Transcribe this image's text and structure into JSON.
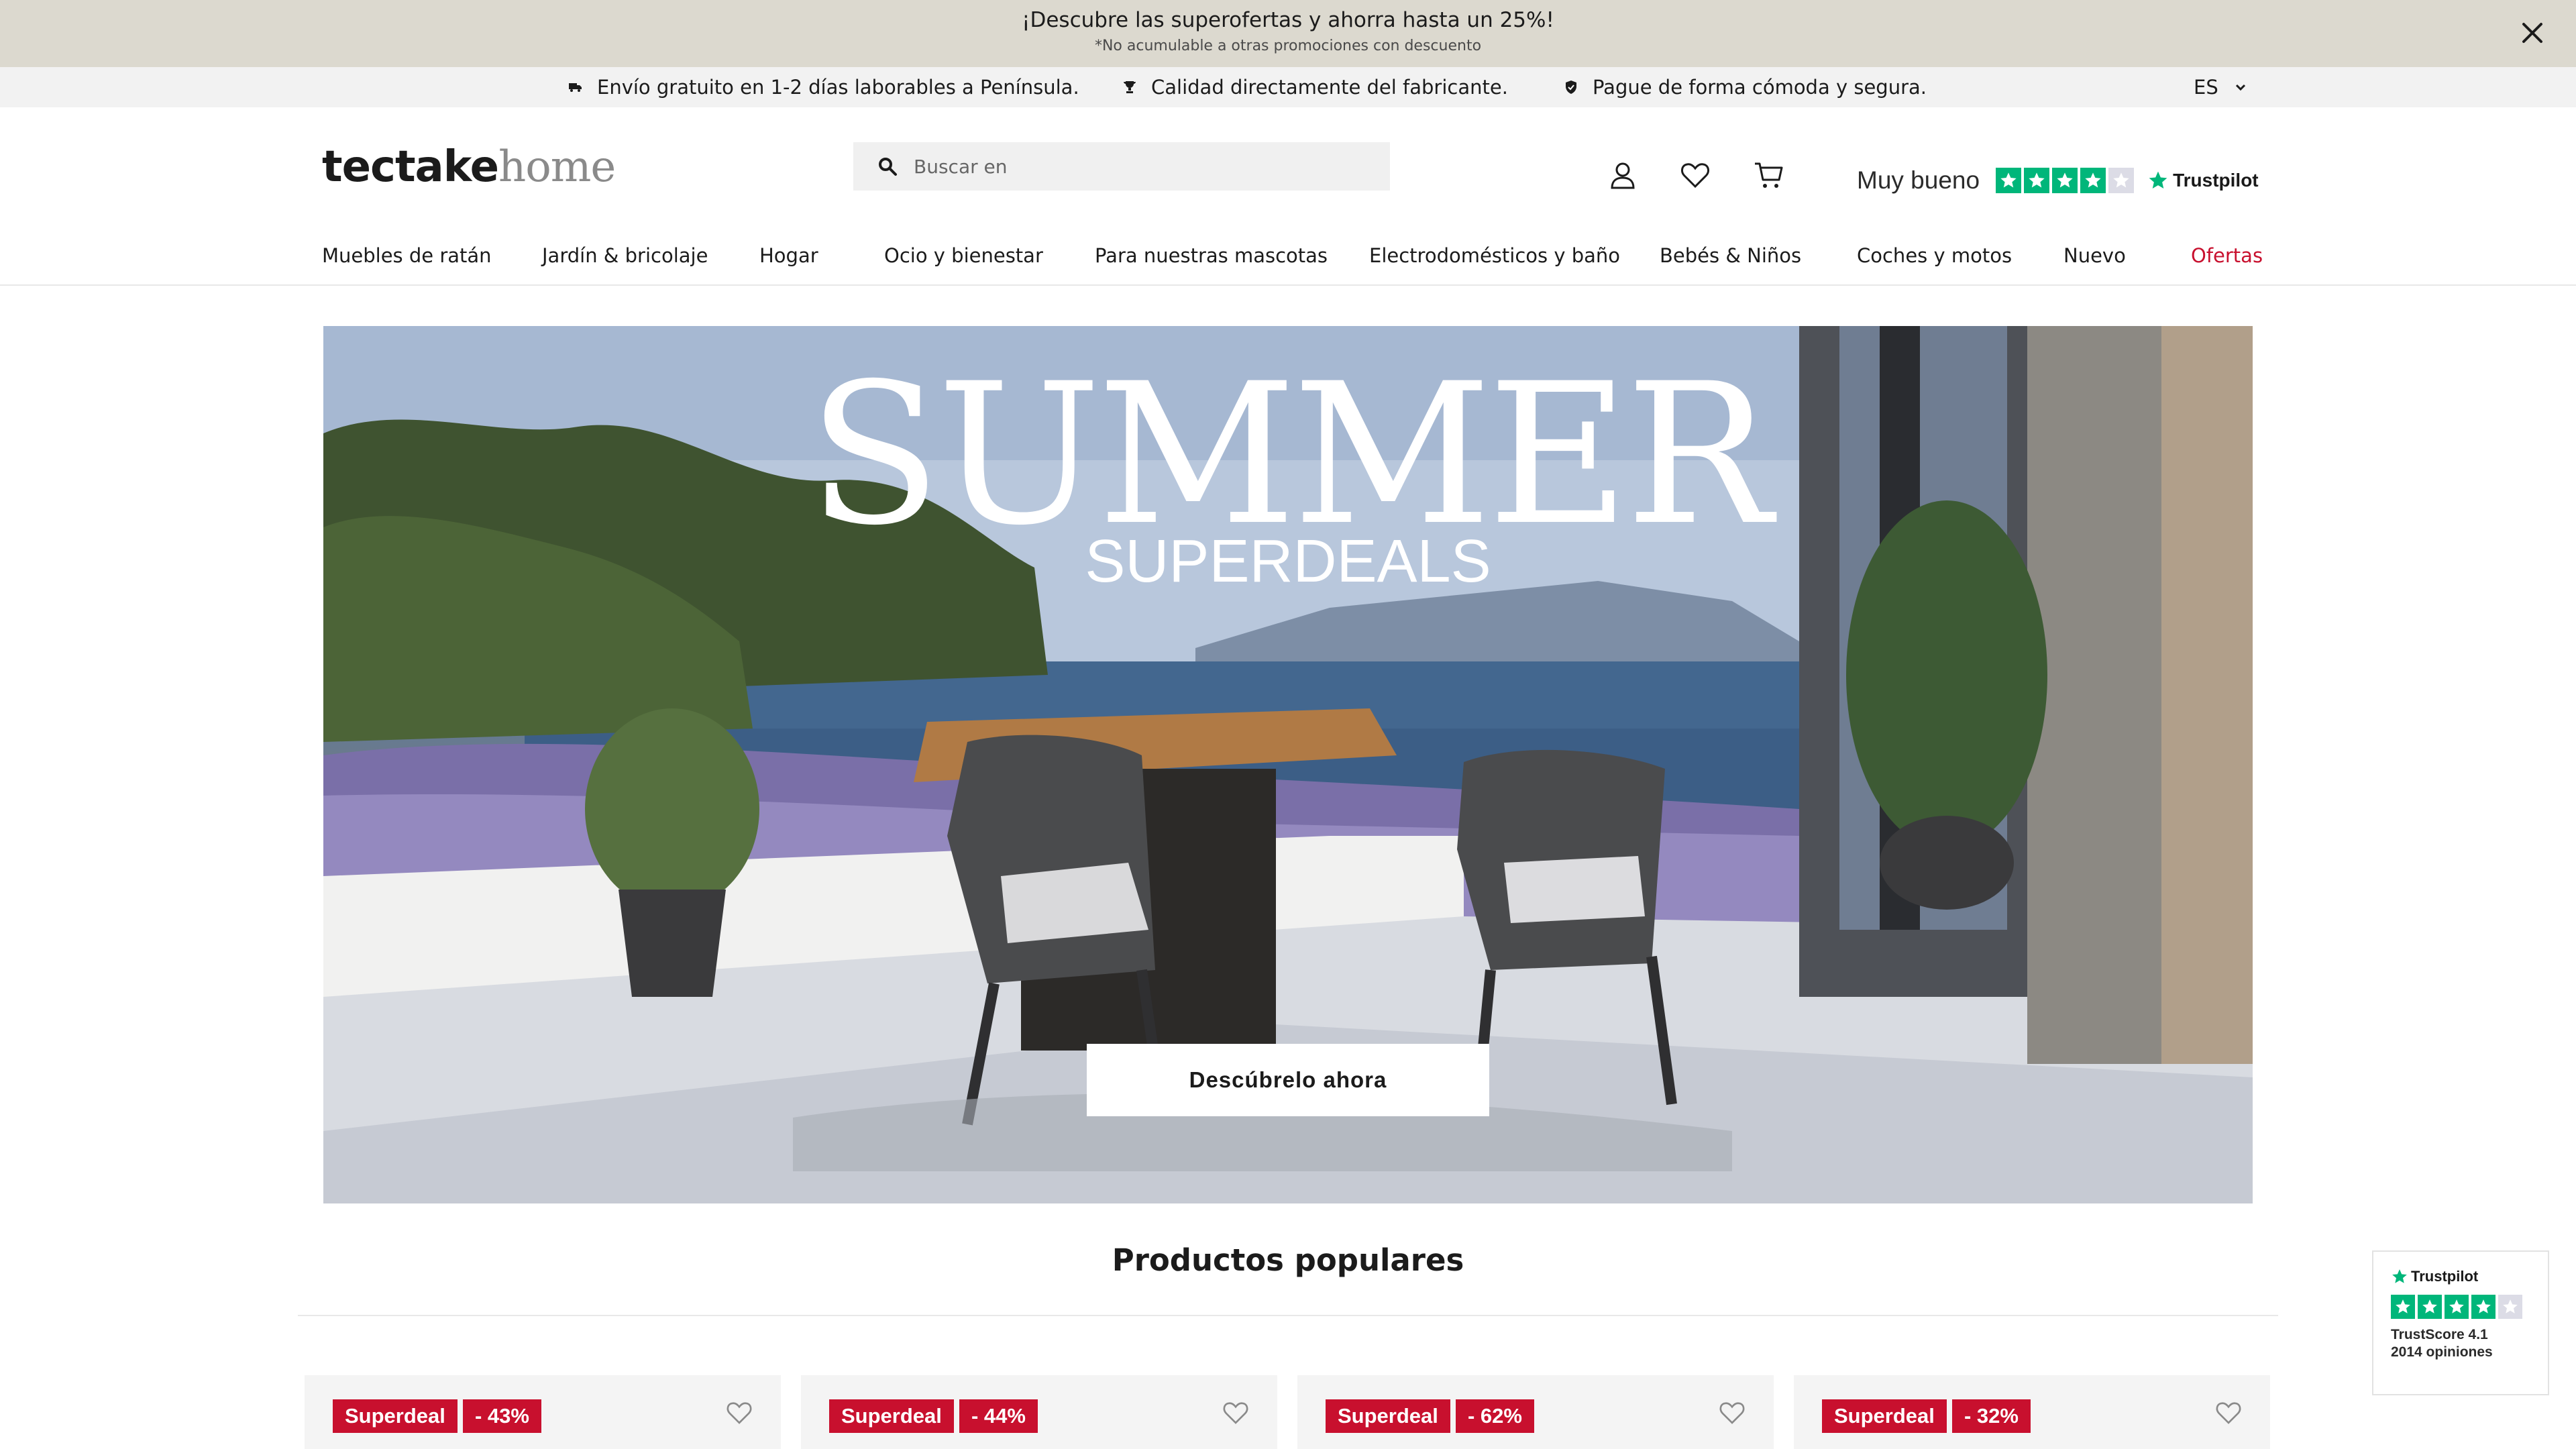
{
  "promo": {
    "title": "¡Descubre las superofertas y ahorra hasta un 25%!",
    "subtitle": "*No acumulable a otras promociones con descuento",
    "close_icon": "close-icon"
  },
  "usp": {
    "items": [
      {
        "icon": "truck-icon",
        "text": "Envío gratuito en 1-2 días laborables a Península."
      },
      {
        "icon": "trophy-icon",
        "text": "Calidad directamente del fabricante."
      },
      {
        "icon": "shield-icon",
        "text": "Pague de forma cómoda y segura."
      }
    ],
    "language": "ES"
  },
  "header": {
    "logo_bold": "tectake",
    "logo_light": "home",
    "search_placeholder": "Buscar en",
    "icons": [
      "user-icon",
      "heart-icon",
      "cart-icon"
    ],
    "trustpilot": {
      "rating_text": "Muy bueno",
      "stars_filled": 4,
      "stars_total": 5,
      "brand": "Trustpilot"
    }
  },
  "nav": {
    "items": [
      "Muebles de ratán",
      "Jardín & bricolaje",
      "Hogar",
      "Ocio y bienestar",
      "Para nuestras mascotas",
      "Electrodomésticos y baño",
      "Bebés & Niños",
      "Coches y motos",
      "Nuevo",
      "Ofertas"
    ]
  },
  "hero": {
    "title": "SUMMER",
    "subtitle": "SUPERDEALS",
    "cta": "Descúbrelo ahora"
  },
  "products": {
    "title": "Productos populares",
    "cards": [
      {
        "badge": "Superdeal",
        "discount": "- 43%"
      },
      {
        "badge": "Superdeal",
        "discount": "- 44%"
      },
      {
        "badge": "Superdeal",
        "discount": "- 62%"
      },
      {
        "badge": "Superdeal",
        "discount": "- 32%"
      }
    ]
  },
  "trustpilot_widget": {
    "brand": "Trustpilot",
    "score": "TrustScore 4.1",
    "reviews": "2014 opiniones",
    "stars_filled": 4
  },
  "colors": {
    "promo_bg": "#dcd9cf",
    "sale_red": "#c8102e",
    "trustpilot_green": "#00b67a"
  }
}
